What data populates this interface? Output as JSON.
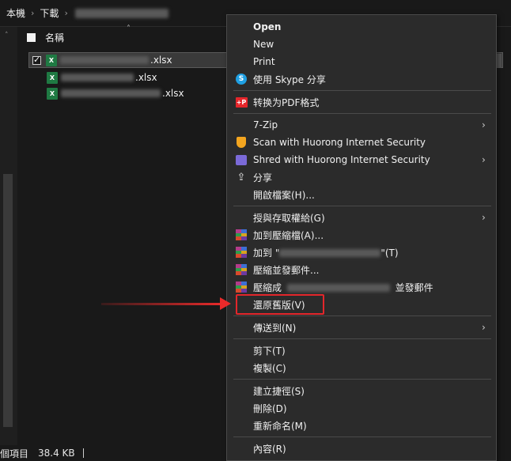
{
  "breadcrumb": {
    "items": [
      "本機",
      "下載"
    ]
  },
  "file_list": {
    "column_name": "名稱",
    "files": [
      {
        "ext": ".xlsx",
        "selected": true
      },
      {
        "ext": ".xlsx",
        "selected": false
      },
      {
        "ext": ".xlsx",
        "selected": false
      }
    ]
  },
  "status_bar": {
    "selection_text": "個項目",
    "size": "38.4 KB"
  },
  "context_menu": {
    "items": {
      "open": "Open",
      "new": "New",
      "print": "Print",
      "skype_share": "使用 Skype 分享",
      "convert_pdf": "转换为PDF格式",
      "zip7": "7-Zip",
      "huorong_scan": "Scan with Huorong Internet Security",
      "huorong_shred": "Shred with Huorong Internet Security",
      "share": "分享",
      "open_with": "開啟檔案(H)...",
      "grant_access": "授與存取權給(G)",
      "add_archive": "加到壓縮檔(A)...",
      "add_to_prefix": "加到 \"",
      "add_to_suffix": "\"(T)",
      "compress_email": "壓縮並發郵件...",
      "compress_to_prefix": "壓縮成",
      "compress_to_suffix": "並發郵件",
      "restore_versions": "還原舊版(V)",
      "send_to": "傳送到(N)",
      "cut": "剪下(T)",
      "copy": "複製(C)",
      "create_shortcut": "建立捷徑(S)",
      "delete": "刪除(D)",
      "rename": "重新命名(M)",
      "properties": "內容(R)"
    },
    "icons": {
      "skype": "S",
      "pdf": "+P",
      "share": "⇪"
    }
  },
  "annotation": {
    "color": "#e3262b"
  }
}
